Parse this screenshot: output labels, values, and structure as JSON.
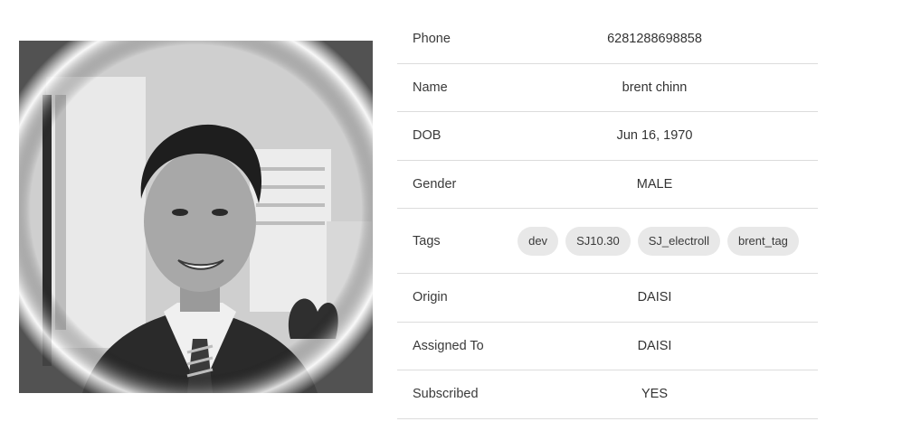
{
  "profile": {
    "fields": [
      {
        "label": "Phone",
        "value": "6281288698858"
      },
      {
        "label": "Name",
        "value": "brent chinn"
      },
      {
        "label": "DOB",
        "value": "Jun 16, 1970"
      },
      {
        "label": "Gender",
        "value": "MALE"
      },
      {
        "label": "Tags",
        "tags": [
          "dev",
          "SJ10.30",
          "SJ_electroll",
          "brent_tag"
        ]
      },
      {
        "label": "Origin",
        "value": "DAISI"
      },
      {
        "label": "Assigned To",
        "value": "DAISI"
      },
      {
        "label": "Subscribed",
        "value": "YES"
      }
    ]
  }
}
